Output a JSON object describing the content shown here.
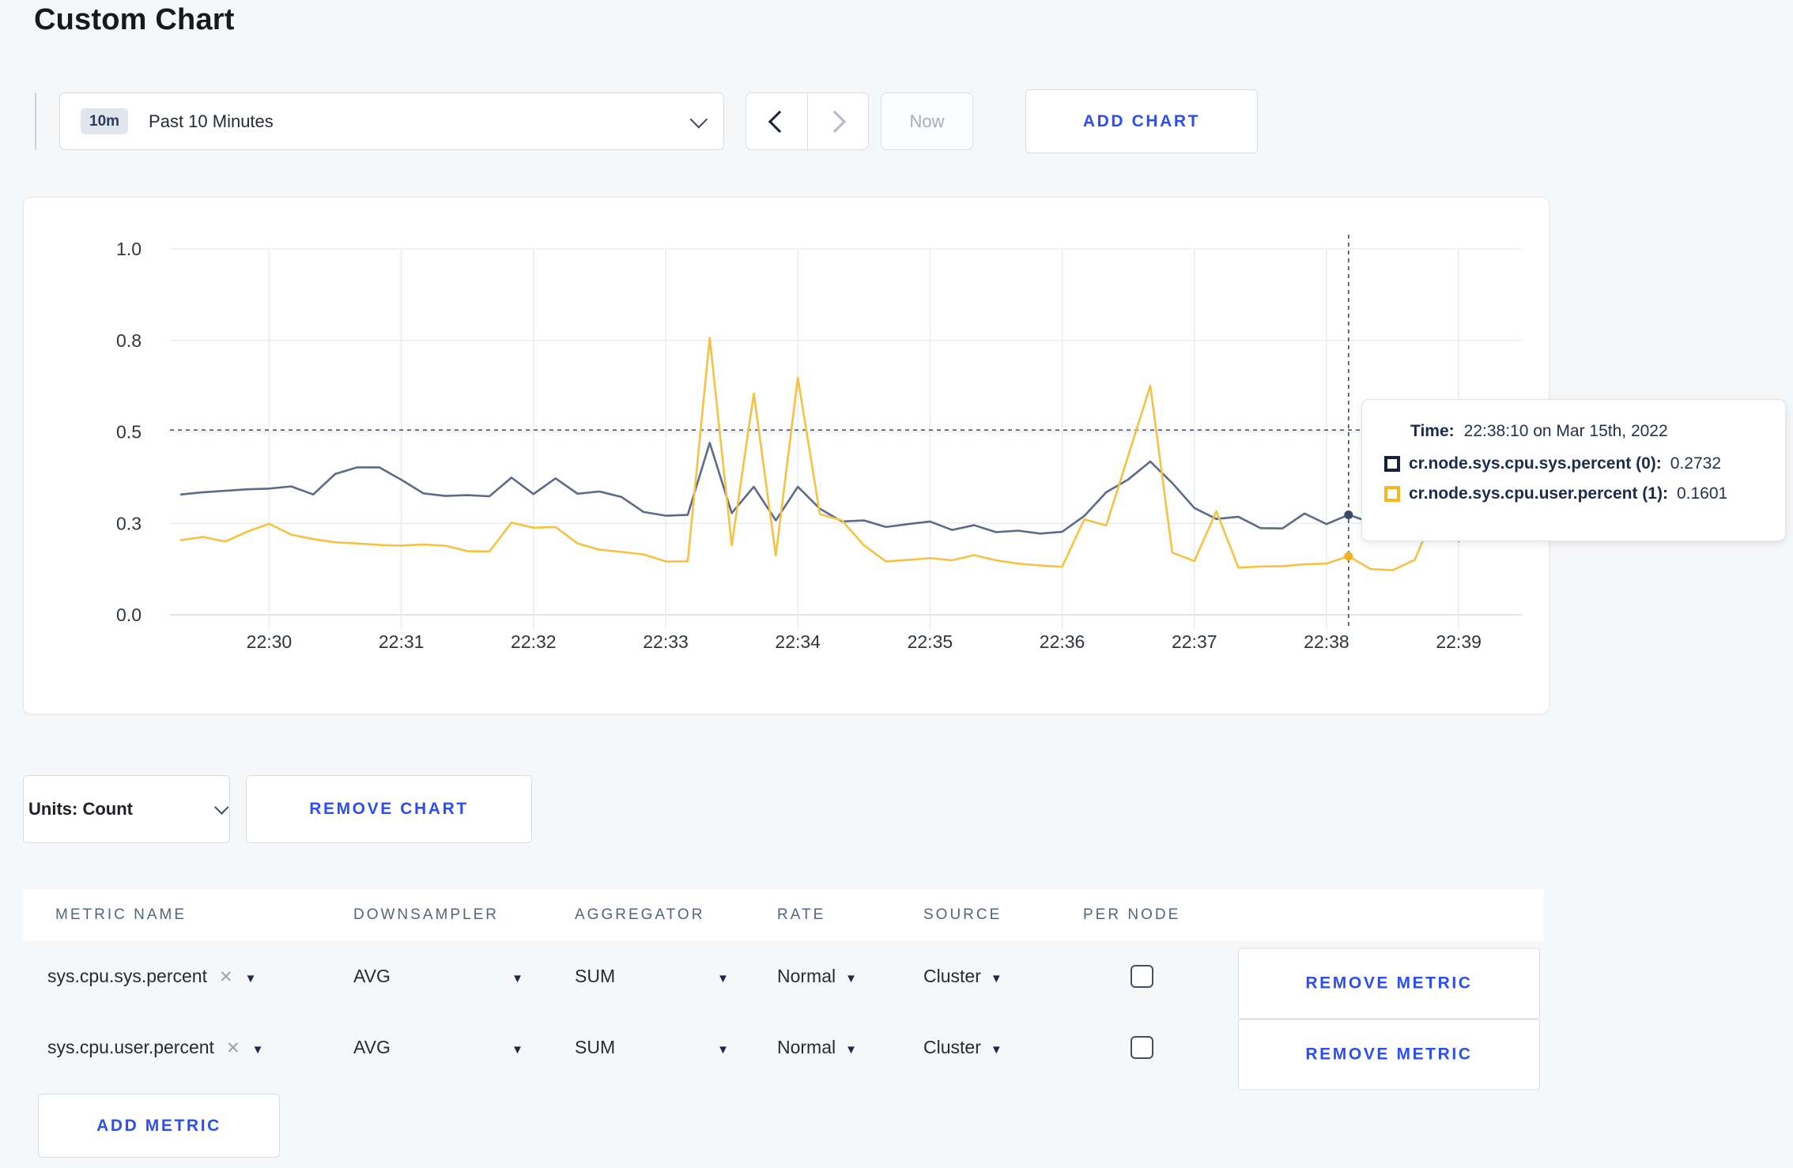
{
  "page": {
    "title": "Custom Chart"
  },
  "toolbar": {
    "time_window_badge": "10m",
    "time_window_label": "Past 10 Minutes",
    "now_label": "Now",
    "add_chart_label": "ADD CHART"
  },
  "chart_data": {
    "type": "line",
    "title": "",
    "xlabel": "",
    "ylabel": "",
    "grid": true,
    "grid_color": "#e8eaee",
    "axis_line_color": "#d9dce1",
    "tick_label_color": "#30363f",
    "x": {
      "start_label": "22:29:20",
      "step_seconds": 10,
      "span_seconds": 590,
      "ticks": [
        {
          "label": "22:30",
          "t": 40
        },
        {
          "label": "22:31",
          "t": 100
        },
        {
          "label": "22:32",
          "t": 160
        },
        {
          "label": "22:33",
          "t": 220
        },
        {
          "label": "22:34",
          "t": 280
        },
        {
          "label": "22:35",
          "t": 340
        },
        {
          "label": "22:36",
          "t": 400
        },
        {
          "label": "22:37",
          "t": 460
        },
        {
          "label": "22:38",
          "t": 520
        },
        {
          "label": "22:39",
          "t": 580
        }
      ]
    },
    "y": {
      "range": [
        0,
        1
      ],
      "ticks": [
        {
          "label": "0.0",
          "v": 0
        },
        {
          "label": "0.3",
          "v": 0.25
        },
        {
          "label": "0.5",
          "v": 0.5
        },
        {
          "label": "0.8",
          "v": 0.75
        },
        {
          "label": "1.0",
          "v": 1
        }
      ]
    },
    "crosshair": {
      "t": 530,
      "h_value": 0.505,
      "color": "#44536e",
      "time": "22:38:10"
    },
    "series": [
      {
        "name": "cr.node.sys.cpu.sys.percent",
        "color": "#5c6b88",
        "swatch_color": "#152142",
        "marker_color": "#3d4a66",
        "marker_value": 0.2732,
        "values": [
          0.329,
          0.335,
          0.339,
          0.343,
          0.345,
          0.351,
          0.329,
          0.385,
          0.403,
          0.403,
          0.369,
          0.332,
          0.325,
          0.327,
          0.324,
          0.375,
          0.33,
          0.373,
          0.331,
          0.337,
          0.322,
          0.281,
          0.271,
          0.273,
          0.47,
          0.278,
          0.35,
          0.258,
          0.35,
          0.29,
          0.255,
          0.258,
          0.24,
          0.248,
          0.255,
          0.232,
          0.245,
          0.226,
          0.23,
          0.222,
          0.227,
          0.27,
          0.335,
          0.37,
          0.419,
          0.36,
          0.292,
          0.262,
          0.268,
          0.237,
          0.236,
          0.277,
          0.248,
          0.2732,
          0.253,
          0.248,
          0.257,
          0.278,
          0.252,
          0.3
        ]
      },
      {
        "name": "cr.node.sys.cpu.user.percent",
        "color": "#f5c244",
        "swatch_color": "#f5b81e",
        "marker_color": "#f0b41f",
        "marker_value": 0.1601,
        "values": [
          0.204,
          0.213,
          0.2,
          0.227,
          0.249,
          0.219,
          0.207,
          0.198,
          0.195,
          0.191,
          0.189,
          0.192,
          0.189,
          0.174,
          0.173,
          0.252,
          0.238,
          0.24,
          0.195,
          0.178,
          0.172,
          0.165,
          0.146,
          0.146,
          0.757,
          0.19,
          0.605,
          0.162,
          0.648,
          0.275,
          0.258,
          0.19,
          0.146,
          0.15,
          0.155,
          0.149,
          0.163,
          0.149,
          0.14,
          0.135,
          0.131,
          0.261,
          0.244,
          0.435,
          0.626,
          0.17,
          0.147,
          0.283,
          0.129,
          0.132,
          0.133,
          0.138,
          0.14,
          0.1601,
          0.125,
          0.122,
          0.15,
          0.29,
          0.2,
          0.274
        ]
      }
    ],
    "tooltip": {
      "time_label": "Time:",
      "time_value": "22:38:10 on Mar 15th, 2022",
      "rows": [
        {
          "label": "cr.node.sys.cpu.sys.percent (0):",
          "value": "0.2732"
        },
        {
          "label": "cr.node.sys.cpu.user.percent (1):",
          "value": "0.1601"
        }
      ]
    }
  },
  "chart_controls": {
    "units_label": "Units: Count",
    "remove_chart_label": "REMOVE CHART"
  },
  "metrics_table": {
    "headers": [
      "METRIC NAME",
      "DOWNSAMPLER",
      "AGGREGATOR",
      "RATE",
      "SOURCE",
      "PER NODE"
    ],
    "rows": [
      {
        "name": "sys.cpu.sys.percent",
        "downsampler": "AVG",
        "aggregator": "SUM",
        "rate": "Normal",
        "source": "Cluster",
        "per_node_checked": false,
        "remove_label": "REMOVE METRIC"
      },
      {
        "name": "sys.cpu.user.percent",
        "downsampler": "AVG",
        "aggregator": "SUM",
        "rate": "Normal",
        "source": "Cluster",
        "per_node_checked": false,
        "remove_label": "REMOVE METRIC"
      }
    ],
    "add_metric_label": "ADD METRIC"
  },
  "colors": {
    "accent_blue": "#2b4ff0",
    "page_background": "#f6f7f9"
  }
}
